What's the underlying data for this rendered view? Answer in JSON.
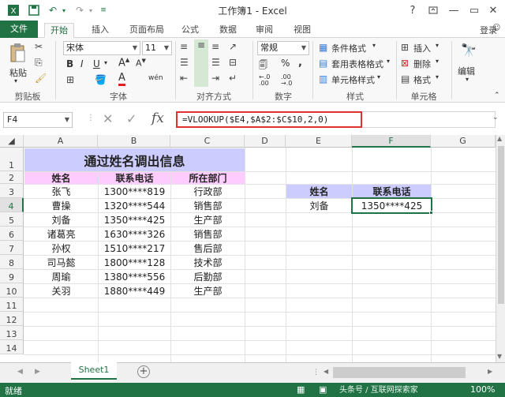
{
  "window": {
    "title": "工作簿1 - Excel",
    "help": "?",
    "login": "登录"
  },
  "tabs": [
    "文件",
    "开始",
    "插入",
    "页面布局",
    "公式",
    "数据",
    "审阅",
    "视图"
  ],
  "ribbon": {
    "paste": "粘贴",
    "font_name": "宋体",
    "font_size": "11",
    "number_format": "常规",
    "cond_format": "条件格式",
    "table_format": "套用表格格式",
    "cell_style": "单元格样式",
    "insert": "插入",
    "delete": "删除",
    "format": "格式",
    "edit": "编辑",
    "groups": [
      "剪贴板",
      "字体",
      "对齐方式",
      "数字",
      "样式",
      "单元格"
    ]
  },
  "namebox": "F4",
  "formula": "=VLOOKUP($E4,$A$2:$C$10,2,0)",
  "columns": [
    "A",
    "B",
    "C",
    "D",
    "E",
    "F",
    "G"
  ],
  "rows": [
    "1",
    "2",
    "3",
    "4",
    "5",
    "6",
    "7",
    "8",
    "9",
    "10",
    "11",
    "12",
    "13",
    "14"
  ],
  "table": {
    "title": "通过姓名调出信息",
    "headers": [
      "姓名",
      "联系电话",
      "所在部门"
    ],
    "data": [
      [
        "张飞",
        "1300****819",
        "行政部"
      ],
      [
        "曹操",
        "1320****544",
        "销售部"
      ],
      [
        "刘备",
        "1350****425",
        "生产部"
      ],
      [
        "诸葛亮",
        "1630****326",
        "销售部"
      ],
      [
        "孙权",
        "1510****217",
        "售后部"
      ],
      [
        "司马懿",
        "1800****128",
        "技术部"
      ],
      [
        "周瑜",
        "1380****556",
        "后勤部"
      ],
      [
        "关羽",
        "1880****449",
        "生产部"
      ]
    ]
  },
  "lookup": {
    "header_name": "姓名",
    "header_phone": "联系电话",
    "name": "刘备",
    "phone": "1350****425"
  },
  "sheet": {
    "name": "Sheet1"
  },
  "status": {
    "ready": "就绪",
    "zoom": "100%",
    "watermark": "头条号 / 互联网探索家"
  },
  "colors": {
    "accent": "#217346",
    "title_fill": "#ccccff",
    "header_fill": "#ffccff",
    "formula_border": "#e03030"
  }
}
